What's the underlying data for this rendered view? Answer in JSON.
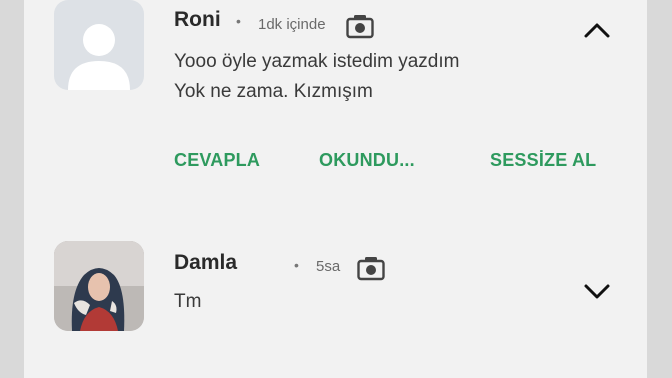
{
  "notifications": [
    {
      "sender": "Roni",
      "separator": "•",
      "time": "1dk içinde",
      "avatar": "default-avatar",
      "messages": [
        "Yooo öyle yazmak istedim yazdım",
        "Yok ne zama. Kızmışım"
      ],
      "expanded": true,
      "actions": [
        "CEVAPLA",
        "OKUNDU...",
        "SESSİZE AL"
      ]
    },
    {
      "sender": "Damla",
      "separator": "•",
      "time": "5sa",
      "avatar": "profile-photo",
      "messages": [
        "Tm"
      ],
      "expanded": false
    }
  ],
  "colors": {
    "action": "#2e9a5e",
    "card_bg": "#f2f2f2",
    "page_bg": "#d9d9d9"
  }
}
